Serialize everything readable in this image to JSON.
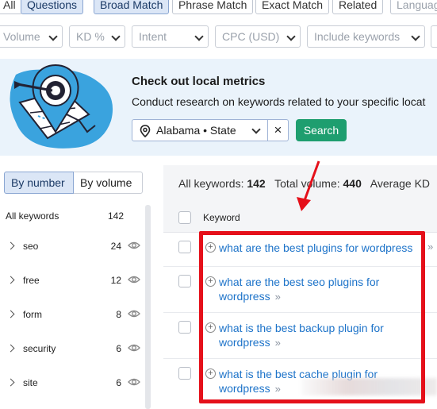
{
  "tabs": [
    "All",
    "Questions",
    "Broad Match",
    "Phrase Match",
    "Exact Match",
    "Related",
    "Languag"
  ],
  "filters": [
    "Volume",
    "KD %",
    "Intent",
    "CPC (USD)",
    "Include keywords"
  ],
  "banner": {
    "title": "Check out local metrics",
    "description": "Conduct research on keywords related to your specific locat",
    "location_value": "Alabama • State",
    "clear_label": "×",
    "search_label": "Search"
  },
  "sidebar": {
    "toggle": [
      "By number",
      "By volume"
    ],
    "header": {
      "label": "All keywords",
      "count": "142"
    },
    "groups": [
      {
        "name": "seo",
        "count": "24"
      },
      {
        "name": "free",
        "count": "12"
      },
      {
        "name": "form",
        "count": "8"
      },
      {
        "name": "security",
        "count": "6"
      },
      {
        "name": "site",
        "count": "6"
      }
    ]
  },
  "summary": {
    "all_keywords_label": "All keywords:",
    "all_keywords_value": "142",
    "total_volume_label": "Total volume:",
    "total_volume_value": "440",
    "average_kd_label": "Average KD"
  },
  "table": {
    "header_keyword": "Keyword",
    "rows": [
      {
        "keyword": "what are the best plugins for wordpress",
        "more": "»"
      },
      {
        "keyword": "what are the best seo plugins for wordpress",
        "more": "»"
      },
      {
        "keyword": "what is the best backup plugin for wordpress",
        "more": "»"
      },
      {
        "keyword": "what is the best cache plugin for wordpress",
        "more": "»"
      }
    ]
  },
  "colors": {
    "accent_link": "#1d73c9",
    "search_button": "#1e9e6f",
    "annotation_red": "#e5101a",
    "banner_bg": "#eaf3fb"
  },
  "icons": [
    "location-pin-icon",
    "chevron-down-icon",
    "close-icon",
    "eye-icon",
    "plus-circle-icon",
    "double-chevron-right-icon",
    "target-pin-illustration"
  ]
}
